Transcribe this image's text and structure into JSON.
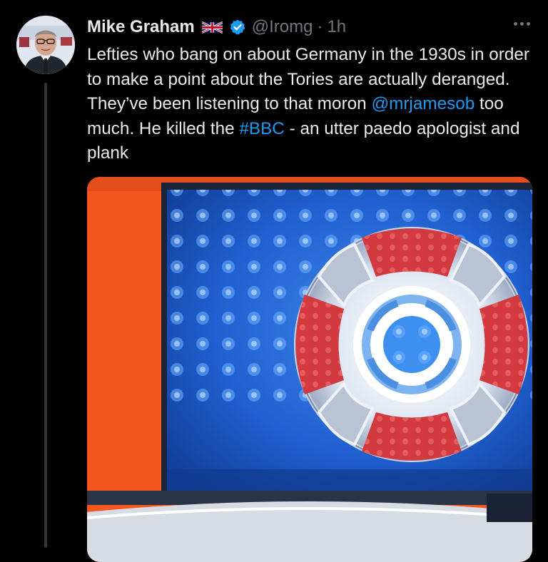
{
  "author": {
    "display_name": "Mike Graham",
    "handle": "@Iromg",
    "time_ago": "1h",
    "dot": "·",
    "flag_icon": "uk-flag-icon",
    "verified_icon": "verified-badge-icon"
  },
  "tweet": {
    "text_1": "Lefties who bang on about Germany in the 1930s in order to make a point about the Tories are actually deranged. They’ve been listening to that moron ",
    "mention": "@mrjamesob",
    "text_2": " too much. He killed the ",
    "hashtag": "#BBC",
    "text_3": " - an utter paedo apologist and plank"
  },
  "colors": {
    "background": "#000000",
    "text": "#e7e9ea",
    "secondary": "#71767b",
    "link": "#1d9bf0",
    "verified": "#1d9bf0"
  }
}
